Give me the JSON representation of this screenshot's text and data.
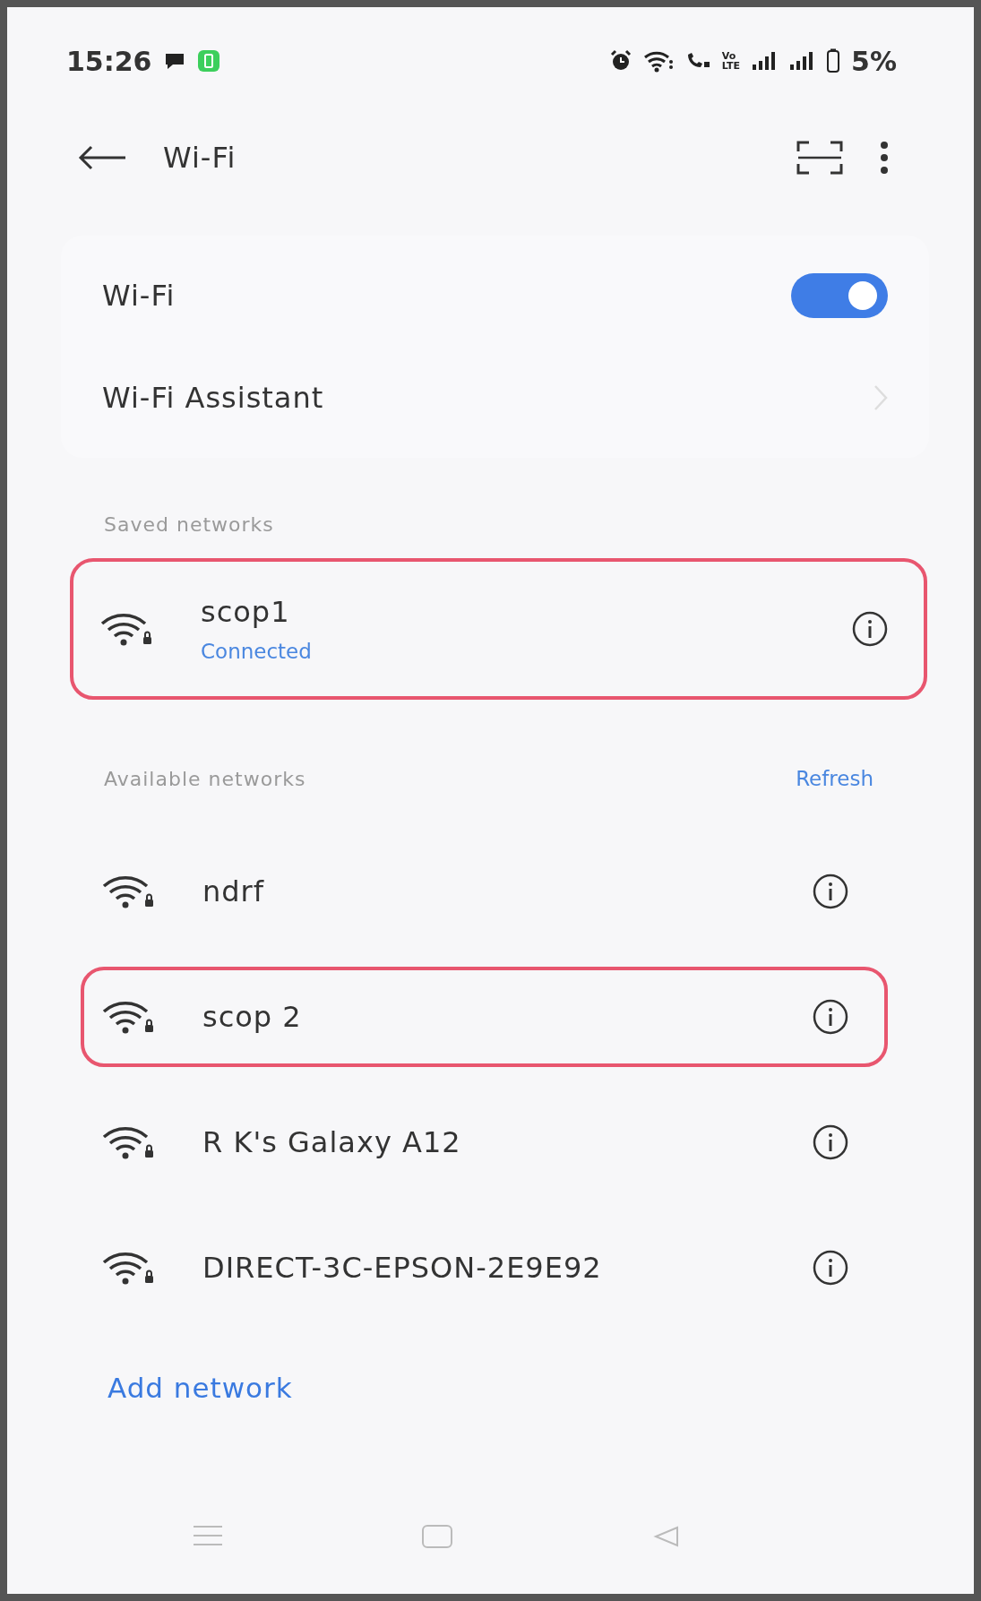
{
  "status_bar": {
    "time": "15:26",
    "volte": [
      "Vo",
      "LTE"
    ],
    "battery": "5%"
  },
  "header": {
    "title": "Wi-Fi"
  },
  "settings": [
    {
      "kind": "toggle",
      "label": "Wi-Fi",
      "on": true
    },
    {
      "kind": "link",
      "label": "Wi-Fi Assistant"
    }
  ],
  "saved_networks": {
    "heading": "Saved networks",
    "items": [
      {
        "name": "scop1",
        "status": "Connected",
        "highlighted": true
      }
    ]
  },
  "available_networks": {
    "heading": "Available networks",
    "refresh": "Refresh",
    "items": [
      {
        "name": "ndrf",
        "highlighted": false
      },
      {
        "name": "scop 2",
        "highlighted": true
      },
      {
        "name": "R K's Galaxy A12",
        "highlighted": false
      },
      {
        "name": "DIRECT-3C-EPSON-2E9E92",
        "highlighted": false
      }
    ]
  },
  "add_network": "Add network"
}
